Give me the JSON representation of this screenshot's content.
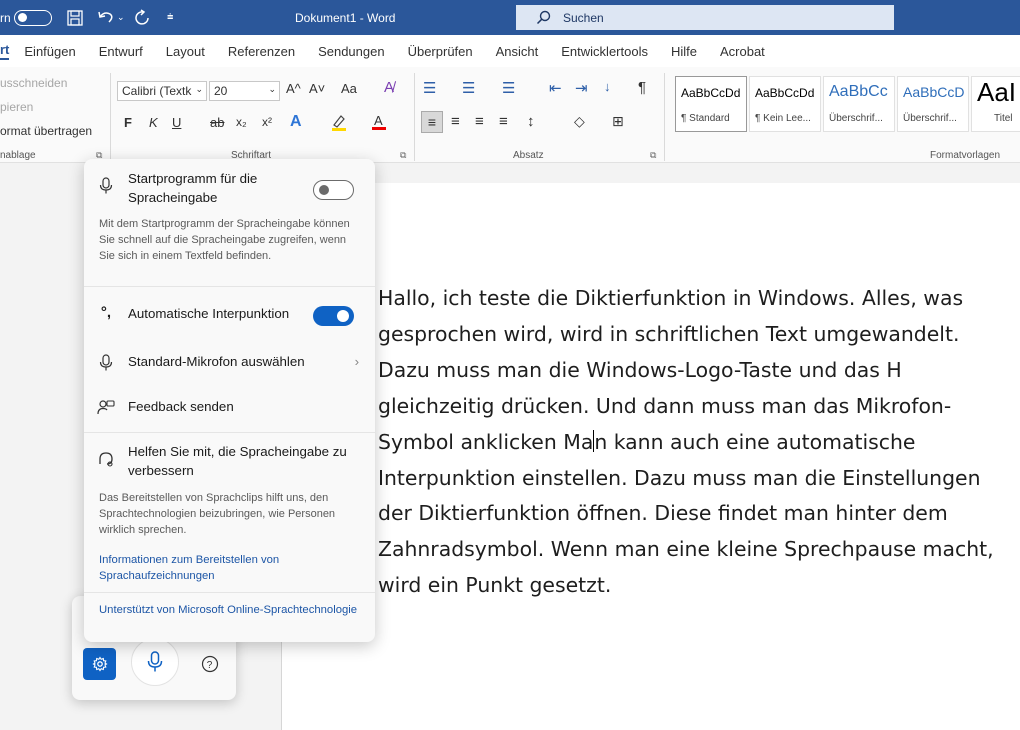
{
  "titlebar": {
    "qat_toggle_label": "rn",
    "doc_title": "Dokument1 - Word",
    "search_label": "Suchen"
  },
  "tabs": [
    "rt",
    "Einfügen",
    "Entwurf",
    "Layout",
    "Referenzen",
    "Sendungen",
    "Überprüfen",
    "Ansicht",
    "Entwicklertools",
    "Hilfe",
    "Acrobat"
  ],
  "clipboard": {
    "cut": "usschneiden",
    "copy": "pieren",
    "format_painter": "ormat übertragen",
    "group_label": "nablage"
  },
  "font": {
    "name": "Calibri (Textk",
    "size": "20",
    "group_label": "Schriftart",
    "bold": "F",
    "italic": "K",
    "underline": "U",
    "strike": "ab",
    "grow": "A^",
    "shrink": "A˅",
    "case": "Aa",
    "sub": "x₂",
    "sup": "x²"
  },
  "paragraph": {
    "group_label": "Absatz"
  },
  "styles": {
    "group_label": "Formatvorlagen",
    "items": [
      {
        "preview": "AaBbCcDd",
        "name": "¶ Standard"
      },
      {
        "preview": "AaBbCcDd",
        "name": "¶ Kein Lee..."
      },
      {
        "preview": "AaBbCc",
        "name": "Überschrif..."
      },
      {
        "preview": "AaBbCcD",
        "name": "Überschrif..."
      },
      {
        "preview": "AaI",
        "name": "Titel"
      }
    ]
  },
  "document": {
    "text_before_cursor": "Hallo, ich teste die Diktierfunktion in Windows. Alles, was gesprochen wird, wird in schriftlichen Text umgewandelt. Dazu muss man die Windows-Logo-Taste und das H gleichzeitig drücken. Und dann muss man das Mikrofon-Symbol anklicken Ma",
    "text_after_cursor": "n kann auch eine automatische Interpunktion einstellen. Dazu muss man die Einstellungen der Diktierfunktion öffnen. Diese findet man hinter dem Zahnradsymbol. Wenn man eine kleine Sprechpause macht, wird ein Punkt gesetzt."
  },
  "voice_panel": {
    "launcher_title": "Startprogramm für die Spracheingabe",
    "launcher_on": false,
    "launcher_desc": "Mit dem Startprogramm der Spracheingabe können Sie schnell auf die Spracheingabe zugreifen, wenn Sie sich in einem Textfeld befinden.",
    "auto_punct": "Automatische Interpunktion",
    "auto_punct_on": true,
    "mic_select": "Standard-Mikrofon auswählen",
    "feedback": "Feedback senden",
    "help_improve": "Helfen Sie mit, die Spracheingabe zu verbessern",
    "help_desc": "Das Bereitstellen von Sprachclips hilft uns, den Sprachtechnologien beizubringen, wie Personen wirklich sprechen.",
    "info_link": "Informationen zum Bereitstellen von Sprachaufzeichnungen",
    "powered_by": "Unterstützt von Microsoft Online-Sprachtechnologie"
  },
  "colors": {
    "titlebar": "#2b579a",
    "accent": "#0f62c4",
    "link": "#1d56a6"
  }
}
